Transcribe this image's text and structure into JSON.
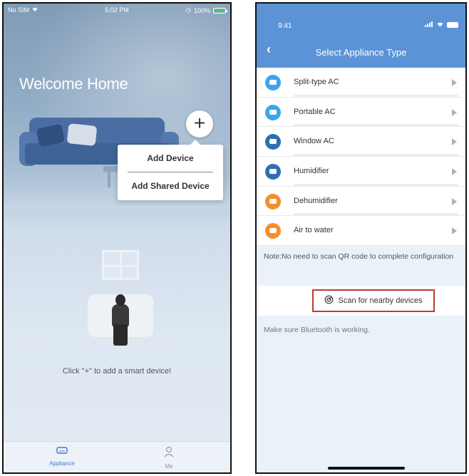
{
  "phone1": {
    "status": {
      "carrier": "No SIM",
      "time": "5:02 PM",
      "battery": "100%"
    },
    "welcome": "Welcome Home",
    "add_button": "+",
    "menu": {
      "add_device": "Add Device",
      "add_shared_device": "Add Shared Device"
    },
    "empty_hint": "Click \"+\" to add a smart device!",
    "tabs": [
      {
        "label": "Appliance",
        "icon": "appliance-icon"
      },
      {
        "label": "Me",
        "icon": "person-icon"
      }
    ],
    "colors": {
      "active_tab": "#3b7bd4"
    }
  },
  "phone2": {
    "status": {
      "time": "9:41"
    },
    "title": "Select Appliance Type",
    "appliances": [
      {
        "label": "Split-type AC",
        "icon": "split-ac-icon",
        "color": "#3ea4ea"
      },
      {
        "label": "Portable AC",
        "icon": "portable-ac-icon",
        "color": "#3ea4ea"
      },
      {
        "label": "Window AC",
        "icon": "window-ac-icon",
        "color": "#2f6fb5"
      },
      {
        "label": "Humidifier",
        "icon": "humidifier-icon",
        "color": "#2f6fb5"
      },
      {
        "label": "Dehumidifier",
        "icon": "dehumidifier-icon",
        "color": "#f58d2a"
      },
      {
        "label": "Air to water",
        "icon": "air-to-water-icon",
        "color": "#f58d2a"
      }
    ],
    "note": "Note:No need to scan QR code to complete configuration",
    "scan_button": "Scan for nearby devices",
    "bluetooth_note": "Make sure Bluetooth is working.",
    "colors": {
      "header": "#5b93d6",
      "highlight_border": "#c0392b"
    }
  }
}
